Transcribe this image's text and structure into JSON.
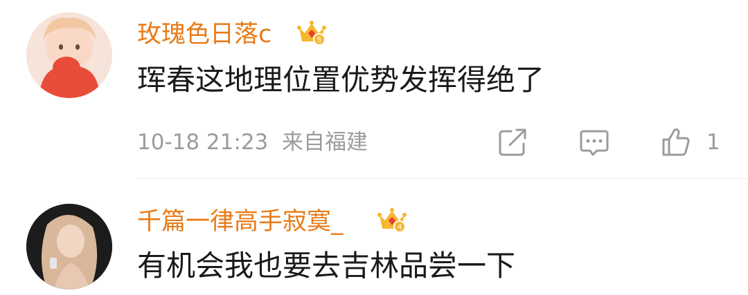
{
  "colors": {
    "username": "#e87b17",
    "meta": "#9b9b9b",
    "text": "#1a1a1a",
    "divider": "#ececec"
  },
  "comments": [
    {
      "username": "玫瑰色日落c",
      "vip_icon": "crown-level-5-icon",
      "vip_level": "5",
      "text": "珲春这地理位置优势发挥得绝了",
      "meta": "10-18 21:23  来自福建",
      "actions": {
        "share_icon": "share-icon",
        "comment_icon": "comment-icon",
        "like_icon": "thumbs-up-icon",
        "like_count": "1"
      }
    },
    {
      "username": "千篇一律高手寂寞_",
      "vip_icon": "crown-level-4-icon",
      "vip_level": "4",
      "text": "有机会我也要去吉林品尝一下"
    }
  ]
}
